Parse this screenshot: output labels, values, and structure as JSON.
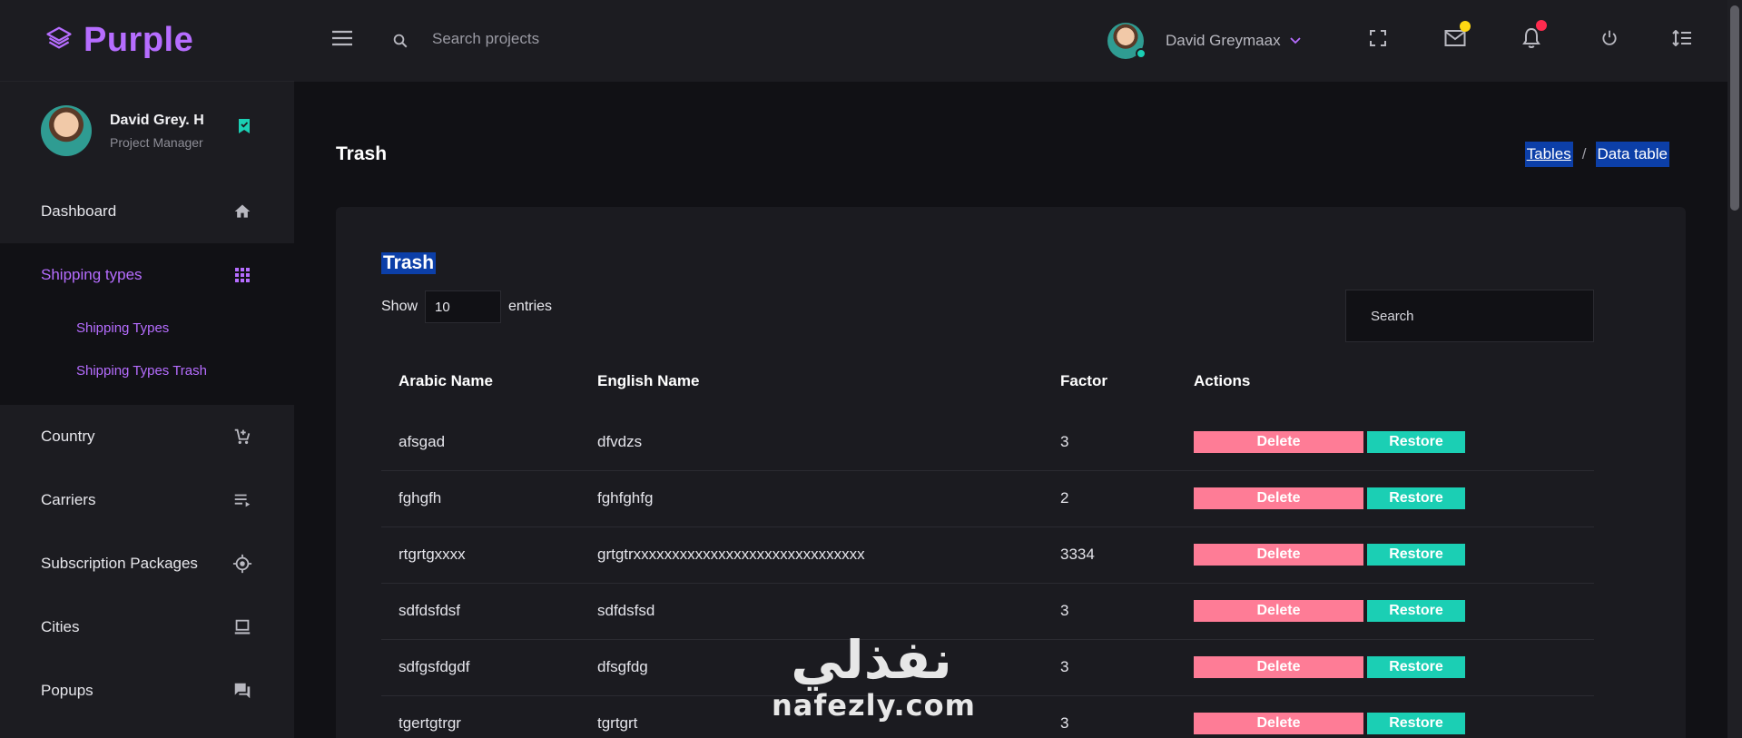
{
  "brand": {
    "name": "Purple",
    "icon": "layers-icon"
  },
  "profile": {
    "name": "David Grey. H",
    "role": "Project Manager",
    "badge_icon": "bookmark-check-icon"
  },
  "sidebar": {
    "items": [
      {
        "label": "Dashboard",
        "icon": "home-icon"
      },
      {
        "label": "Shipping types",
        "icon": "apps-grid-icon",
        "active": true,
        "children": [
          {
            "label": "Shipping Types"
          },
          {
            "label": "Shipping Types Trash"
          }
        ]
      },
      {
        "label": "Country",
        "icon": "cart-plus-icon"
      },
      {
        "label": "Carriers",
        "icon": "playlist-icon"
      },
      {
        "label": "Subscription Packages",
        "icon": "crosshairs-icon"
      },
      {
        "label": "Cities",
        "icon": "laptop-icon"
      },
      {
        "label": "Popups",
        "icon": "forum-icon"
      }
    ]
  },
  "topbar": {
    "search_placeholder": "Search projects",
    "user_name": "David Greymaax",
    "icons": [
      "menu-icon",
      "search-icon",
      "fullscreen-icon",
      "mail-icon",
      "bell-icon",
      "power-icon",
      "format-line-spacing-icon"
    ],
    "mail_dot_color": "#fed713",
    "bell_dot_color": "#fe2b4e"
  },
  "page": {
    "title": "Trash",
    "breadcrumb": [
      "Tables",
      "Data table"
    ]
  },
  "table_card": {
    "title": "Trash",
    "length": {
      "show_label": "Show",
      "value": "10",
      "entries_label": "entries"
    },
    "search_placeholder": "Search",
    "columns": [
      "Arabic Name",
      "English Name",
      "Factor",
      "Actions"
    ],
    "rows": [
      {
        "arabic": "afsgad",
        "english": "dfvdzs",
        "factor": "3"
      },
      {
        "arabic": "fghgfh",
        "english": "fghfghfg",
        "factor": "2"
      },
      {
        "arabic": "rtgrtgxxxx",
        "english": "grtgtrxxxxxxxxxxxxxxxxxxxxxxxxxxxxxx",
        "factor": "3334"
      },
      {
        "arabic": "sdfdsfdsf",
        "english": "sdfdsfsd",
        "factor": "3"
      },
      {
        "arabic": "sdfgsfdgdf",
        "english": "dfsgfdg",
        "factor": "3"
      },
      {
        "arabic": "tgertgtrgr",
        "english": "tgrtgrt",
        "factor": "3"
      }
    ],
    "actions": {
      "delete": "Delete",
      "restore": "Restore"
    }
  },
  "colors": {
    "accent": "#b66dff",
    "delete": "#fe7c96",
    "restore": "#1bcfb4",
    "highlight": "#0c3fa8"
  },
  "watermark": {
    "arabic": "نفذلي",
    "latin": "nafezly.com"
  }
}
